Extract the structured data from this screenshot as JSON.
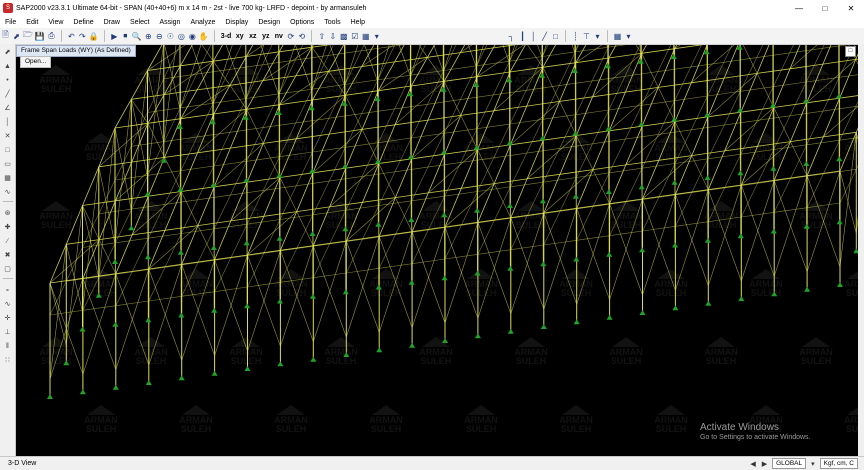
{
  "window": {
    "title": "SAP2000 v23.3.1 Ultimate 64-bit - SPAN (40+40+6) m x 14 m - 2st - live 700 kg- LRFD - depoint - by armansuleh",
    "app_icon": "sap2000-logo-icon"
  },
  "menu": [
    "File",
    "Edit",
    "View",
    "Define",
    "Draw",
    "Select",
    "Assign",
    "Analyze",
    "Display",
    "Design",
    "Options",
    "Tools",
    "Help"
  ],
  "toolbar": {
    "view_buttons": [
      "3-d",
      "xy",
      "xz",
      "yz",
      "nv"
    ]
  },
  "view": {
    "tab_label": "Frame Span Loads (WY) (As Defined)",
    "open_tooltip": "Open...",
    "watermark": "ARMAN SULEH",
    "colors": {
      "background": "#000000",
      "frames": "#e8e85a",
      "supports": "#1fa32a"
    }
  },
  "activation": {
    "line1": "Activate Windows",
    "line2": "Go to Settings to activate Windows."
  },
  "status": {
    "view_label": "3-D View",
    "coord_system": "GLOBAL",
    "units": "Kgf, cm, C"
  }
}
